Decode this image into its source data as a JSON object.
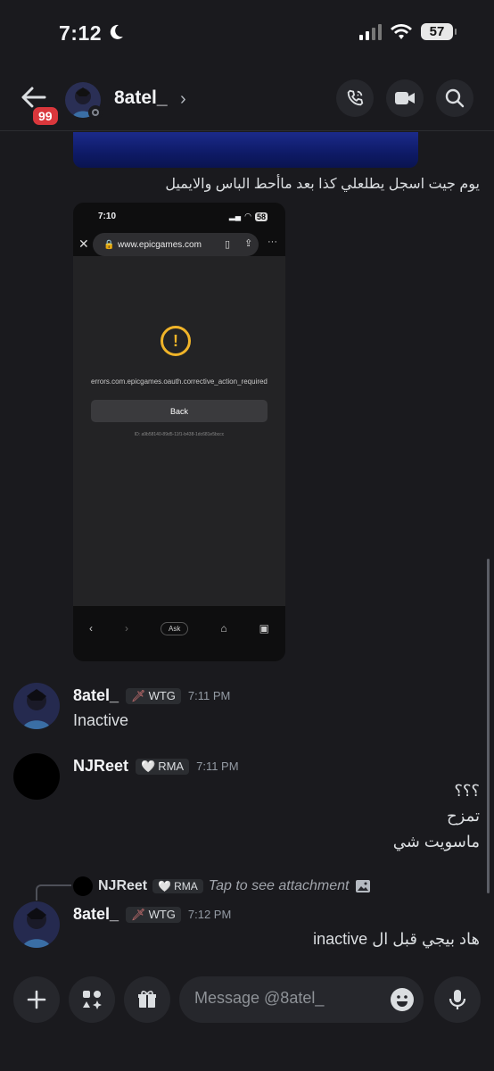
{
  "status_bar": {
    "time": "7:12",
    "battery": "57"
  },
  "header": {
    "unread_badge": "99",
    "username": "8atel_",
    "chevron": "›"
  },
  "chat": {
    "caption_message": "يوم جيت اسجل يطلعلي كذا بعد ماأحط الباس والايميل",
    "screenshot": {
      "time": "7:10",
      "battery": "58",
      "url": "www.epicgames.com",
      "warning_symbol": "!",
      "error_text": "errors.com.epicgames.oauth.corrective_action_required",
      "back_button": "Back",
      "error_id": "ID: a9b58140-89d5-11f1-b438-1dc681e5bccc",
      "ask_label": "Ask"
    },
    "messages": [
      {
        "author": "8atel_",
        "role_name": "WTG",
        "time": "7:11 PM",
        "lines": [
          "Inactive"
        ]
      },
      {
        "author": "NJReet",
        "role_name": "RMA",
        "time": "7:11 PM",
        "lines": [
          "؟؟؟",
          "تمزح",
          "ماسويت شي"
        ]
      },
      {
        "author": "8atel_",
        "role_name": "WTG",
        "time": "7:12 PM",
        "lines": [
          "هاد بيجي قبل ال inactive"
        ],
        "reply": {
          "author": "NJReet",
          "role_name": "RMA",
          "text": "Tap to see attachment"
        }
      }
    ]
  },
  "composer": {
    "placeholder": "Message @8atel_"
  },
  "colors": {
    "background": "#1a1a1e",
    "badge": "#da373c",
    "warning": "#f0b429"
  }
}
